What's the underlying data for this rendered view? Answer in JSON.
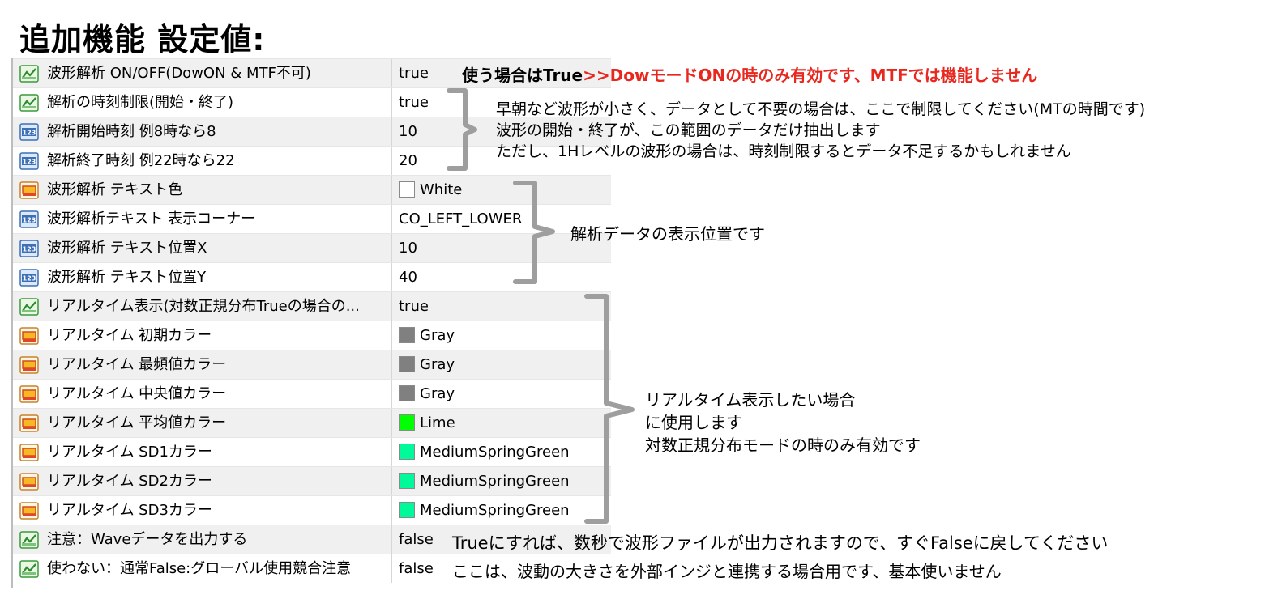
{
  "title": "追加機能 設定値:",
  "rows": [
    {
      "name": "波形解析 ON/OFF(DowON & MTF不可)",
      "value": "true",
      "icon": "bool-toggle-icon",
      "swatch": null
    },
    {
      "name": "解析の時刻制限(開始・終了)",
      "value": "true",
      "icon": "bool-toggle-icon",
      "swatch": null
    },
    {
      "name": "解析開始時刻 例8時なら8",
      "value": "10",
      "icon": "number-123-icon",
      "swatch": null
    },
    {
      "name": "解析終了時刻 例22時なら22",
      "value": "20",
      "icon": "number-123-icon",
      "swatch": null
    },
    {
      "name": "波形解析 テキスト色",
      "value": "White",
      "icon": "color-palette-icon",
      "swatch": "#ffffff"
    },
    {
      "name": "波形解析テキスト 表示コーナー",
      "value": "CO_LEFT_LOWER",
      "icon": "number-123-icon",
      "swatch": null
    },
    {
      "name": "波形解析 テキスト位置X",
      "value": "10",
      "icon": "number-123-icon",
      "swatch": null
    },
    {
      "name": "波形解析 テキスト位置Y",
      "value": "40",
      "icon": "number-123-icon",
      "swatch": null
    },
    {
      "name": "リアルタイム表示(対数正規分布Trueの場合の...",
      "value": "true",
      "icon": "bool-toggle-icon",
      "swatch": null
    },
    {
      "name": "リアルタイム 初期カラー",
      "value": "Gray",
      "icon": "color-palette-icon",
      "swatch": "#808080"
    },
    {
      "name": "リアルタイム 最頻値カラー",
      "value": "Gray",
      "icon": "color-palette-icon",
      "swatch": "#808080"
    },
    {
      "name": "リアルタイム 中央値カラー",
      "value": "Gray",
      "icon": "color-palette-icon",
      "swatch": "#808080"
    },
    {
      "name": "リアルタイム 平均値カラー",
      "value": "Lime",
      "icon": "color-palette-icon",
      "swatch": "#00ff00"
    },
    {
      "name": "リアルタイム SD1カラー",
      "value": "MediumSpringGreen",
      "icon": "color-palette-icon",
      "swatch": "#00fa9a"
    },
    {
      "name": "リアルタイム SD2カラー",
      "value": "MediumSpringGreen",
      "icon": "color-palette-icon",
      "swatch": "#00fa9a"
    },
    {
      "name": "リアルタイム SD3カラー",
      "value": "MediumSpringGreen",
      "icon": "color-palette-icon",
      "swatch": "#00fa9a"
    },
    {
      "name": "注意：Waveデータを出力する",
      "value": "false",
      "icon": "bool-toggle-icon",
      "swatch": null
    },
    {
      "name": "使わない：通常False:グローバル使用競合注意",
      "value": "false",
      "icon": "bool-toggle-icon",
      "swatch": null
    }
  ],
  "notes": {
    "n1_black": "使う場合はTrue",
    "n1_red": ">>DowモードONの時のみ有効です、MTFでは機能しません",
    "n2_line1": "早朝など波形が小さく、データとして不要の場合は、ここで制限してください(MTの時間です)",
    "n2_line2": "波形の開始・終了が、この範囲のデータだけ抽出します",
    "n2_line3": "ただし、1Hレベルの波形の場合は、時刻制限するとデータ不足するかもしれません",
    "n3": "解析データの表示位置です",
    "n4_line1": "リアルタイム表示したい場合",
    "n4_line2": "に使用します",
    "n4_line3": "対数正規分布モードの時のみ有効です",
    "n5": "Trueにすれば、数秒で波形ファイルが出力されますので、すぐFalseに戻してください",
    "n6": "ここは、波動の大きさを外部インジと連携する場合用です、基本使いません"
  },
  "colors": {
    "accent_red": "#e8271f",
    "bracket_gray": "#9e9e9e"
  }
}
